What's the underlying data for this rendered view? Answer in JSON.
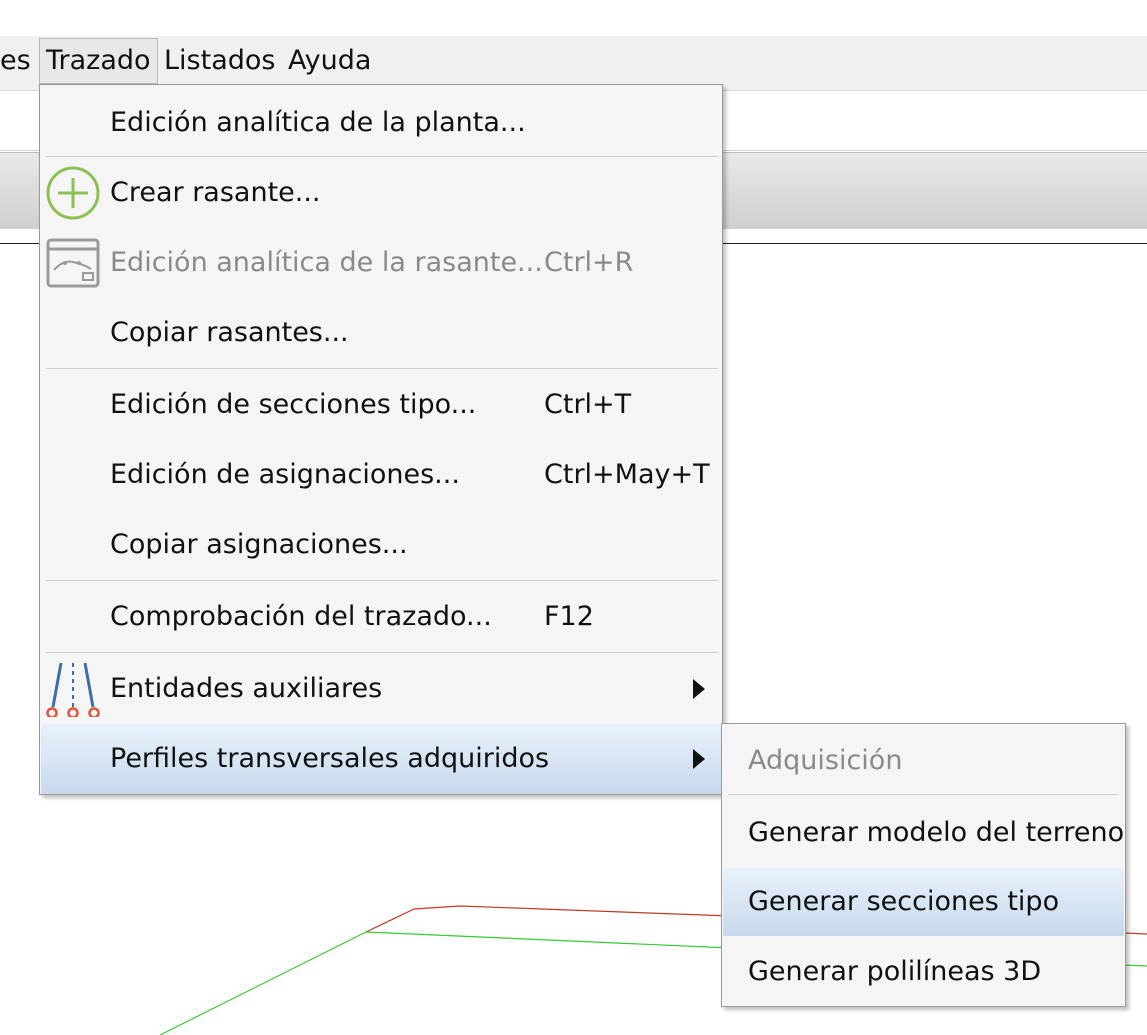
{
  "menubar": {
    "items": [
      "es",
      "Trazado",
      "Listados",
      "Ayuda"
    ]
  },
  "menu": {
    "items": [
      {
        "label": "Edición analítica de la planta...",
        "shortcut": "",
        "icon": "",
        "disabled": false
      },
      {
        "label": "Crear rasante...",
        "shortcut": "",
        "icon": "plus-circle-icon",
        "disabled": false
      },
      {
        "label": "Edición analítica de la rasante...",
        "shortcut": "Ctrl+R",
        "icon": "profile-window-icon",
        "disabled": true
      },
      {
        "label": "Copiar rasantes...",
        "shortcut": "",
        "icon": "",
        "disabled": false
      },
      {
        "label": "Edición de secciones tipo...",
        "shortcut": "Ctrl+T",
        "icon": "",
        "disabled": false
      },
      {
        "label": "Edición de asignaciones...",
        "shortcut": "Ctrl+May+T",
        "icon": "",
        "disabled": false
      },
      {
        "label": "Copiar asignaciones...",
        "shortcut": "",
        "icon": "",
        "disabled": false
      },
      {
        "label": "Comprobación del trazado...",
        "shortcut": "F12",
        "icon": "",
        "disabled": false
      },
      {
        "label": "Entidades auxiliares",
        "shortcut": "",
        "icon": "road-lanes-icon",
        "disabled": false,
        "submenu": true
      },
      {
        "label": "Perfiles transversales adquiridos",
        "shortcut": "",
        "icon": "",
        "disabled": false,
        "submenu": true,
        "highlighted": true
      }
    ]
  },
  "submenu": {
    "items": [
      {
        "label": "Adquisición",
        "disabled": true
      },
      {
        "label": "Generar modelo del terreno",
        "disabled": false
      },
      {
        "label": "Generar secciones tipo",
        "disabled": false,
        "highlighted": true
      },
      {
        "label": "Generar polilíneas 3D",
        "disabled": false
      }
    ]
  },
  "colors": {
    "menu_bg": "#f5f5f5",
    "highlight_top": "#e8f1fb",
    "highlight_bottom": "#c8d9ec",
    "disabled_text": "#8a8a8a",
    "icon_green": "#8cc152",
    "icon_blue": "#3a6ea5",
    "icon_red": "#e0533c",
    "cad_red": "#c0392b",
    "cad_green": "#33cc33"
  }
}
